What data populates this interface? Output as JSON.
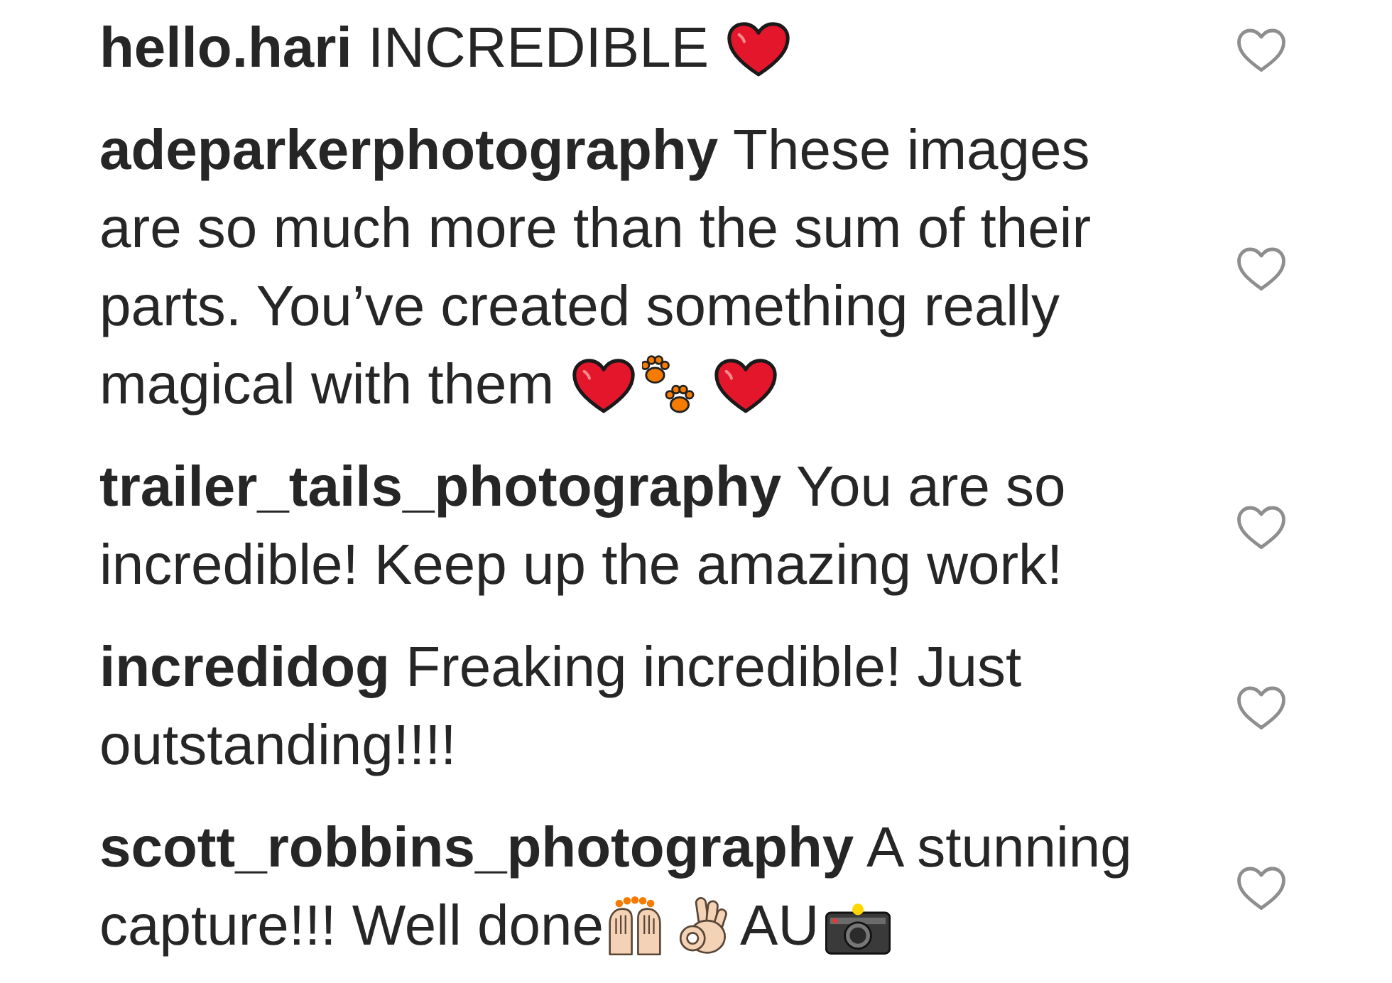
{
  "comments": [
    {
      "username": "hello.hari",
      "content": [
        {
          "kind": "text",
          "text": "INCREDIBLE"
        },
        {
          "kind": "heart"
        }
      ],
      "liked": false
    },
    {
      "username": "adeparkerphotography",
      "content": [
        {
          "kind": "text",
          "text": "These images are so much more than the sum of their parts. You’ve created something really magical with them"
        },
        {
          "kind": "heart"
        },
        {
          "kind": "paws"
        },
        {
          "kind": "heart"
        }
      ],
      "liked": false
    },
    {
      "username": "trailer_tails_photography",
      "content": [
        {
          "kind": "text",
          "text": "You are so incredible! Keep up the amazing work!"
        }
      ],
      "liked": false
    },
    {
      "username": "incredidog",
      "content": [
        {
          "kind": "text",
          "text": "Freaking incredible! Just outstanding!!!!"
        }
      ],
      "liked": false
    },
    {
      "username": "scott_robbins_photography",
      "content": [
        {
          "kind": "text",
          "text": "A stunning capture!!! Well done"
        },
        {
          "kind": "raised_hands"
        },
        {
          "kind": "ok_hand"
        },
        {
          "kind": "text",
          "text": "AU"
        },
        {
          "kind": "camera"
        }
      ],
      "liked": false
    }
  ]
}
